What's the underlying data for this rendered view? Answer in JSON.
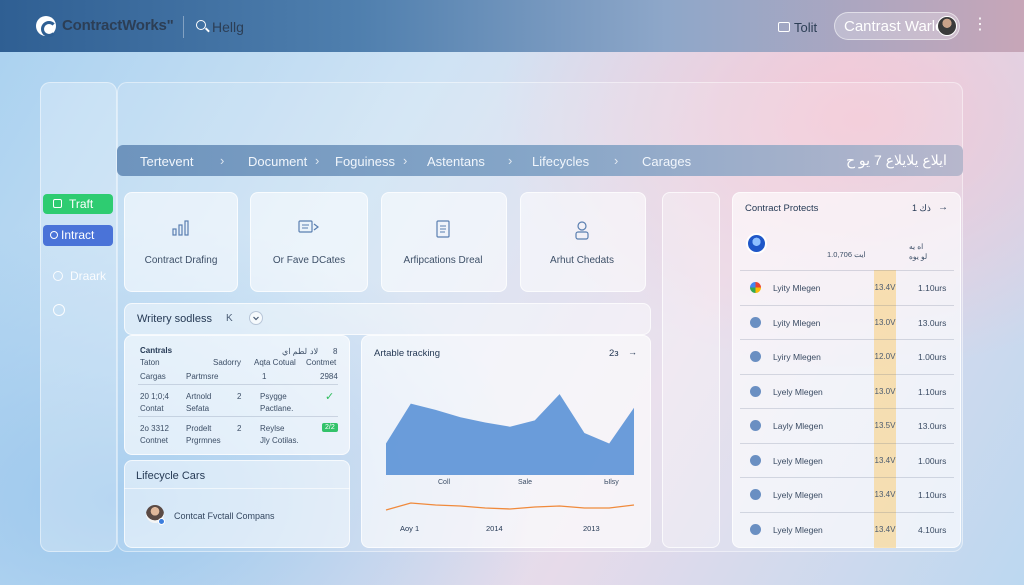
{
  "app": {
    "name": "ContractWorks\"",
    "search": "Hellg",
    "tools": "Tolit",
    "user": "Cantrast Warld",
    "more": "⋮"
  },
  "sidebar": {
    "buttons": [
      {
        "label": "Traft",
        "color": "#2ecc71"
      },
      {
        "label": "Intract",
        "color": "#4a73d8"
      }
    ],
    "items": [
      {
        "label": "Draark"
      }
    ]
  },
  "breadcrumb": {
    "items": [
      "Tertevent",
      "Document",
      "Foguiness",
      "Astentans",
      "Lifecycles",
      "Carages"
    ],
    "separator": "›",
    "right": "ايلاع يلايلاع 7 يو ح"
  },
  "feature_cards": [
    {
      "title": "Contract Drafing",
      "icon": "bar-chart-icon"
    },
    {
      "title": "Or Fave DCates",
      "icon": "message-icon"
    },
    {
      "title": "Arfipcations Dreal",
      "icon": "document-icon"
    },
    {
      "title": "Arhut Chedats",
      "icon": "user-badge-icon"
    }
  ],
  "workflow": {
    "title": "Writery sodless",
    "chip": "K",
    "table": {
      "title": "Cantrals",
      "header_right": [
        "لطم اي",
        "لاد",
        "8"
      ],
      "row1": [
        "Taton",
        "Sadorry",
        "Aqta Cotual",
        "Contmet"
      ],
      "row2": [
        "Cargas",
        "Partmsre",
        "1",
        "2984"
      ],
      "row3": {
        "c1a": "20 1;0;4",
        "c1b": "Contat",
        "c2a": "Artnold",
        "c2b": "Sefata",
        "c3": "2",
        "c4a": "Psygge",
        "c4b": "Pactlane."
      },
      "row4": {
        "c1a": "2o 3312",
        "c1b": "Contnet",
        "c2a": "Prodelt",
        "c2b": "Prgrmnes",
        "c3": "2",
        "c4a": "Reylse",
        "c4b": "Jly Cotilas.",
        "badge": "2/2"
      }
    }
  },
  "lifecycle": {
    "title": "Lifecycle Cars",
    "item": "Contcat Fvctall Compans"
  },
  "tracking": {
    "title": "Artable tracking",
    "count": "2з",
    "legend": [
      "Coll",
      "Sale",
      "Ыlsy"
    ],
    "x_labels": [
      "Aoy 1",
      "2014",
      "2013"
    ]
  },
  "chart_data": {
    "type": "area",
    "title": "Artable tracking",
    "series": [
      {
        "values": [
          30,
          68,
          62,
          55,
          50,
          46,
          52,
          77,
          40,
          30,
          64
        ]
      },
      {
        "values": [
          5,
          12,
          10,
          9,
          7,
          6,
          8,
          9,
          7,
          7,
          10
        ]
      }
    ],
    "ylim": [
      0,
      100
    ],
    "colors": [
      "#5b92d6",
      "#f08a3c"
    ]
  },
  "projects": {
    "title": "Contract Protects",
    "page": "1 ذك",
    "header_col1": "ايت 1.0,706",
    "header_col2": "اه يه",
    "header_col2b": "لو يوه",
    "rows": [
      {
        "name": "Lyity Mlegen",
        "num": "13.4V",
        "time": "1.10urs"
      },
      {
        "name": "Lyity Mlegen",
        "num": "13.0V",
        "time": "13.0urs"
      },
      {
        "name": "Lyiry Mlegen",
        "num": "12.0V",
        "time": "1.00urs"
      },
      {
        "name": "Lyely Mlegen",
        "num": "13.0V",
        "time": "1.10urs"
      },
      {
        "name": "Layly Mlegen",
        "num": "13.5V",
        "time": "13.0urs"
      },
      {
        "name": "Lyely Mlegen",
        "num": "13.4V",
        "time": "1.00urs"
      },
      {
        "name": "Lyely Mlegen",
        "num": "13.4V",
        "time": "1.10urs"
      },
      {
        "name": "Lyely Mlegen",
        "num": "13.4V",
        "time": "4.10urs"
      }
    ]
  }
}
